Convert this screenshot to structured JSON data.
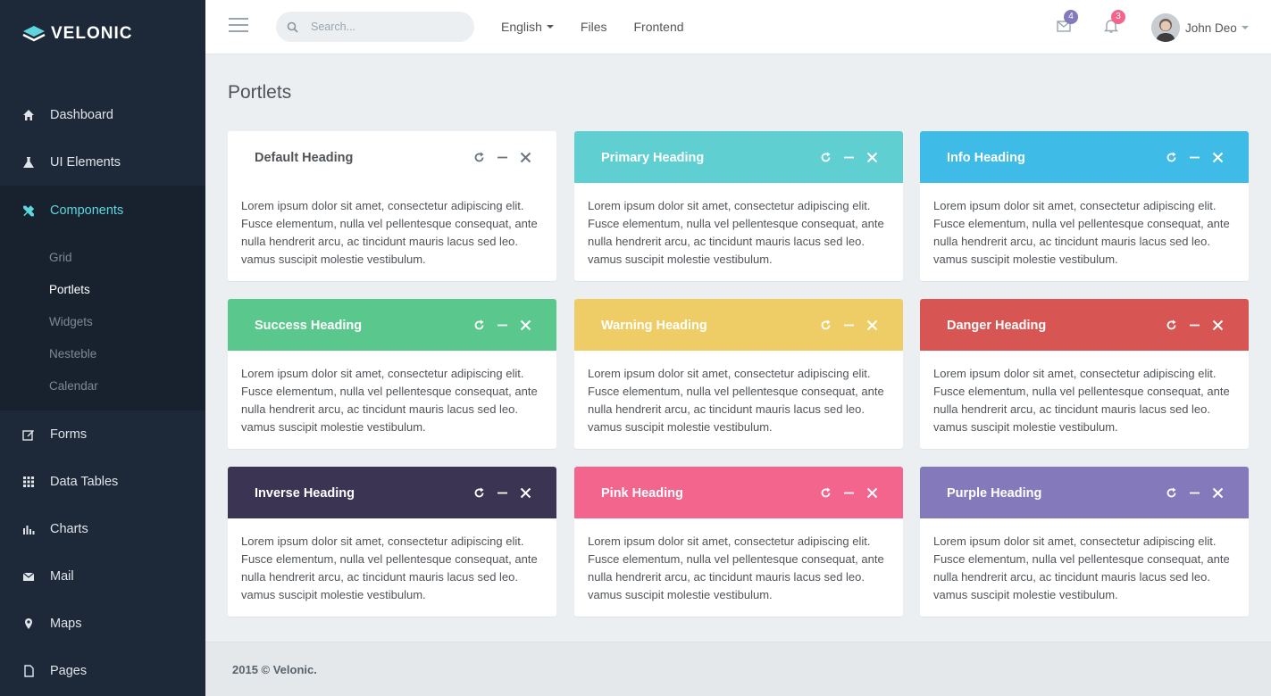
{
  "brand": {
    "name": "VELONIC"
  },
  "sidebar": {
    "items": [
      {
        "label": "Dashboard",
        "icon": "home-icon"
      },
      {
        "label": "UI Elements",
        "icon": "flask-icon"
      },
      {
        "label": "Components",
        "icon": "tools-icon"
      },
      {
        "label": "Forms",
        "icon": "edit-icon"
      },
      {
        "label": "Data Tables",
        "icon": "grid-icon"
      },
      {
        "label": "Charts",
        "icon": "bar-chart-icon"
      },
      {
        "label": "Mail",
        "icon": "mail-icon"
      },
      {
        "label": "Maps",
        "icon": "map-pin-icon"
      },
      {
        "label": "Pages",
        "icon": "page-icon"
      }
    ],
    "components_sub": [
      {
        "label": "Grid"
      },
      {
        "label": "Portlets"
      },
      {
        "label": "Widgets"
      },
      {
        "label": "Nesteble"
      },
      {
        "label": "Calendar"
      }
    ]
  },
  "topbar": {
    "search_placeholder": "Search...",
    "nav": {
      "language": "English",
      "files": "Files",
      "frontend": "Frontend"
    },
    "mail_count": "4",
    "notif_count": "3",
    "user_name": "John Deo"
  },
  "main": {
    "page_title": "Portlets",
    "portlet_body": "Lorem ipsum dolor sit amet, consectetur adipiscing elit. Fusce elementum, nulla vel pellentesque consequat, ante nulla hendrerit arcu, ac tincidunt mauris lacus sed leo. vamus suscipit molestie vestibulum.",
    "portlets": [
      {
        "title": "Default Heading",
        "color": "#ffffff"
      },
      {
        "title": "Primary Heading",
        "color": "#5fcfd2"
      },
      {
        "title": "Info Heading",
        "color": "#3ebbe6"
      },
      {
        "title": "Success Heading",
        "color": "#5ac88d"
      },
      {
        "title": "Warning Heading",
        "color": "#efcd66"
      },
      {
        "title": "Danger Heading",
        "color": "#d75552"
      },
      {
        "title": "Inverse Heading",
        "color": "#3b3452"
      },
      {
        "title": "Pink Heading",
        "color": "#f3658d"
      },
      {
        "title": "Purple Heading",
        "color": "#8479ba"
      }
    ]
  },
  "footer": {
    "text": "2015 © Velonic."
  }
}
